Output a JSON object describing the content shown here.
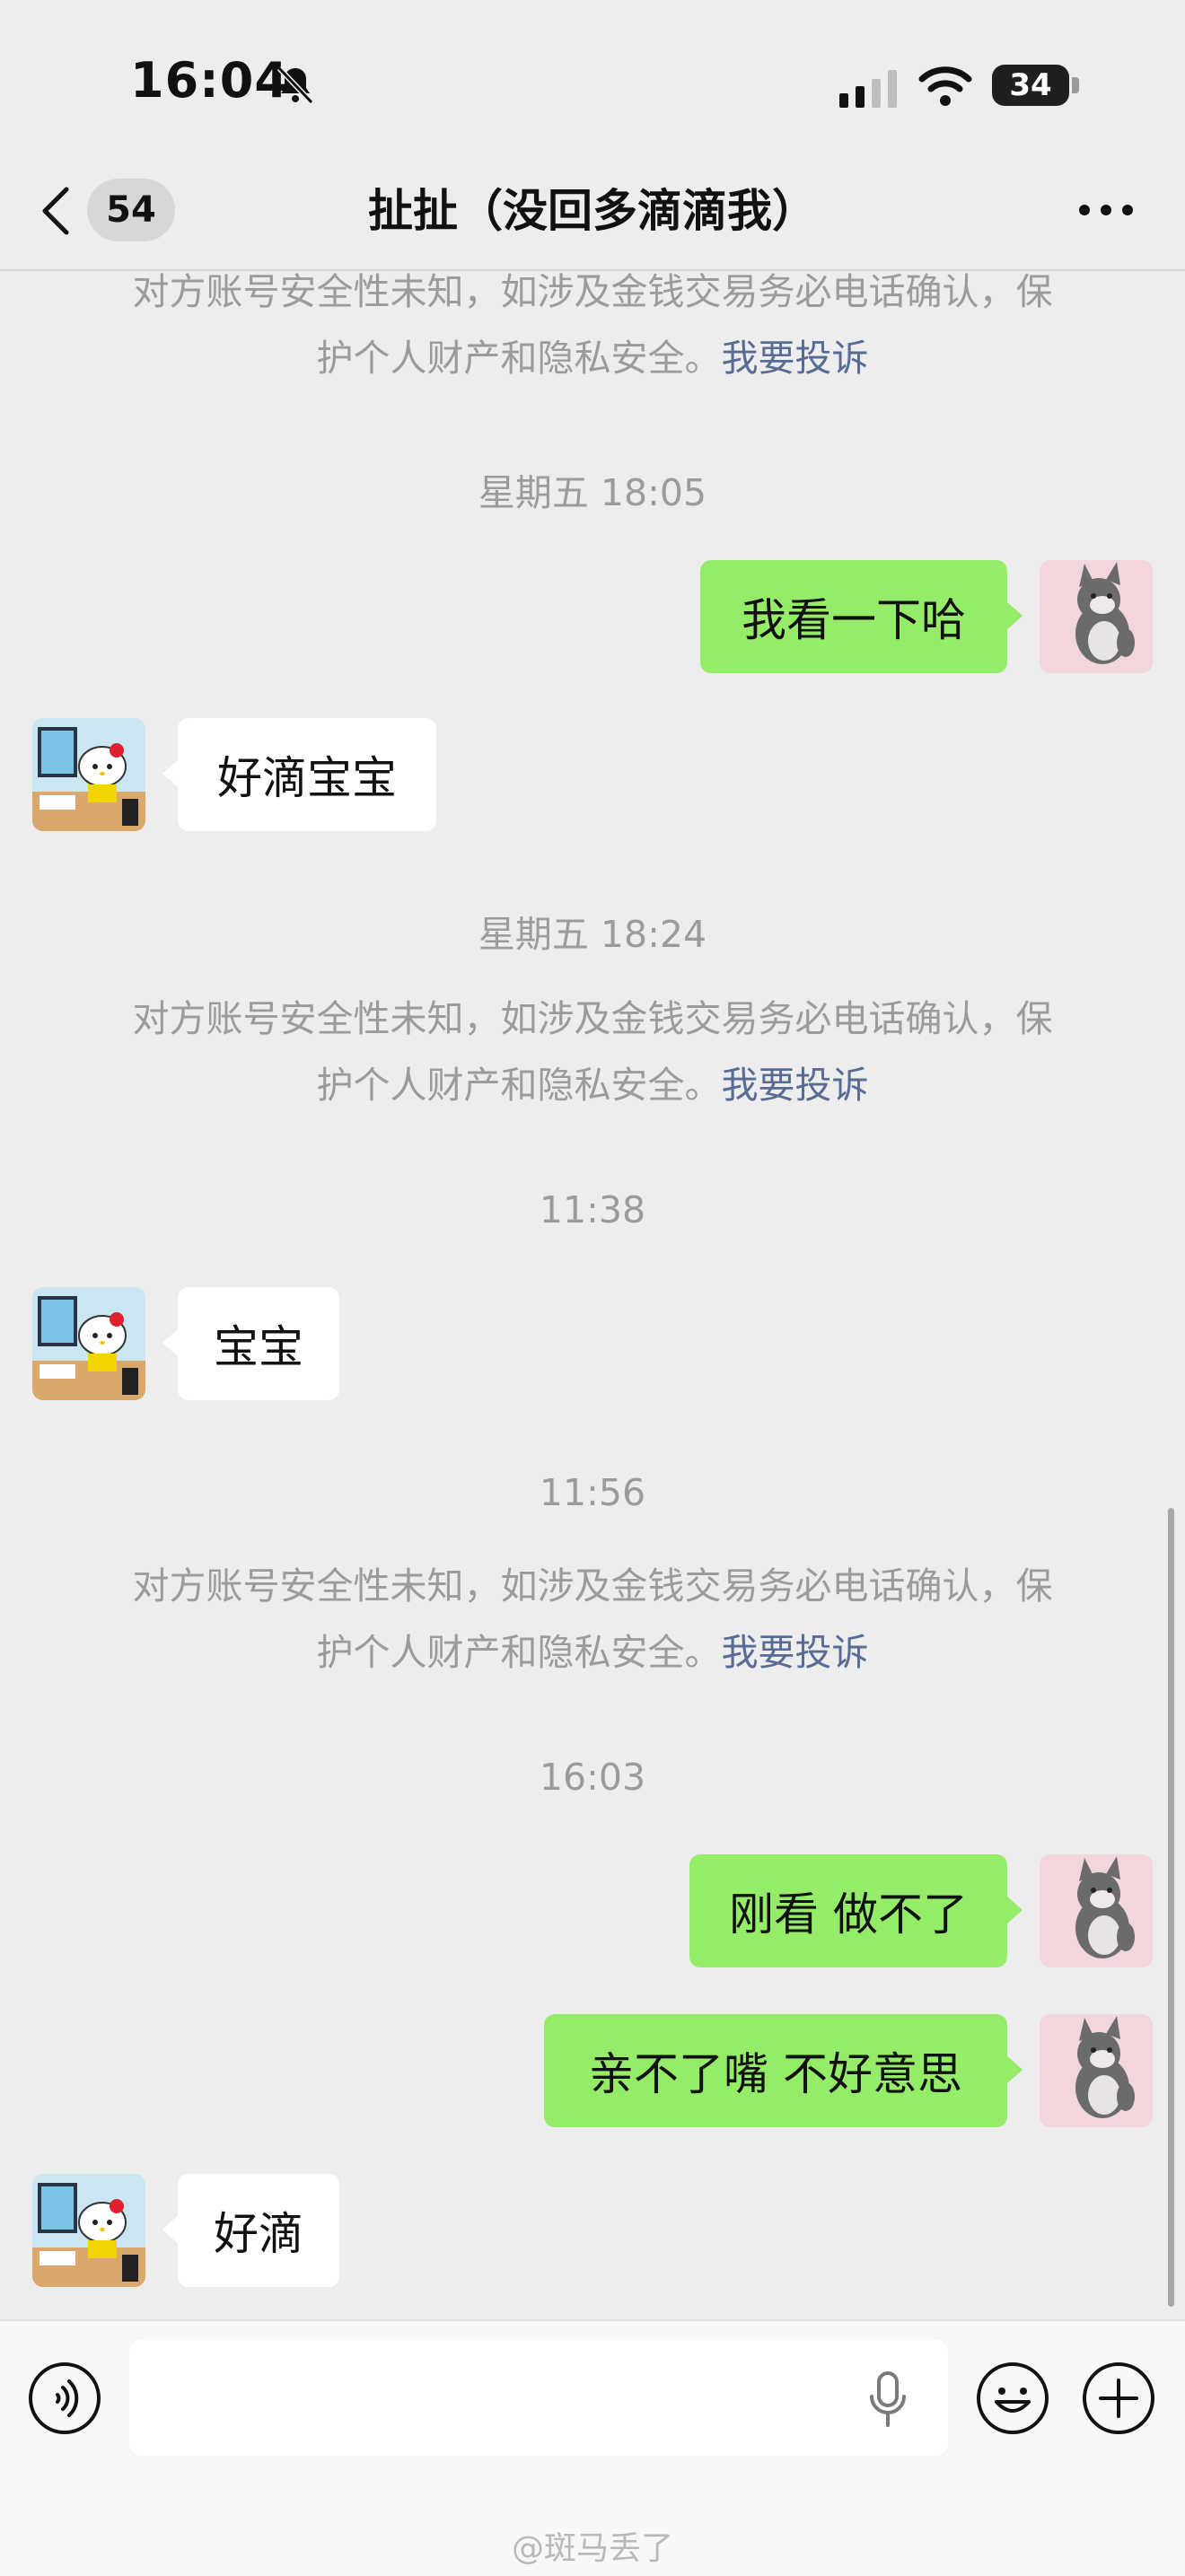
{
  "status_bar": {
    "time": "16:04",
    "battery": "34"
  },
  "nav": {
    "unread_count": "54",
    "title": "扯扯（没回多滴滴我）"
  },
  "safety_notice": {
    "line1": "对方账号安全性未知，如涉及金钱交易务必电话确认，保",
    "line2": "护个人财产和隐私安全。",
    "link": "我要投诉"
  },
  "timestamps": [
    "星期五 18:05",
    "星期五 18:24",
    "11:38",
    "11:56",
    "16:03"
  ],
  "messages": [
    {
      "from": "me",
      "text": "我看一下哈"
    },
    {
      "from": "them",
      "text": "好滴宝宝"
    },
    {
      "from": "them",
      "text": "宝宝"
    },
    {
      "from": "me",
      "text": "刚看 做不了"
    },
    {
      "from": "me",
      "text": "亲不了嘴 不好意思"
    },
    {
      "from": "them",
      "text": "好滴"
    }
  ],
  "input": {
    "placeholder": ""
  },
  "watermark": "@斑马丢了",
  "icons": {
    "back": "chevron-left-icon",
    "more": "more-dots-icon",
    "voice": "voice-icon",
    "mic": "mic-icon",
    "emoji": "emoji-icon",
    "plus": "plus-icon"
  },
  "colors": {
    "my_bubble": "#95ec69",
    "their_bubble": "#ffffff",
    "link": "#576b95",
    "background": "#ededed"
  }
}
